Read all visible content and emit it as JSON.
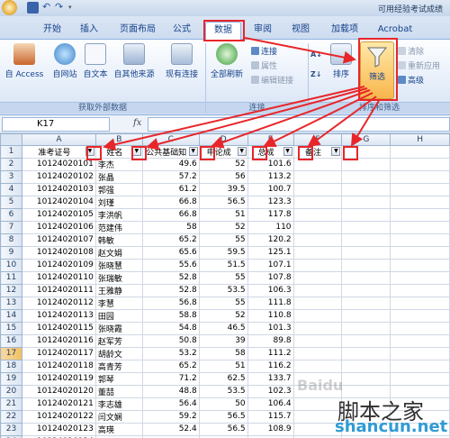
{
  "title_bar": {
    "title": "可用经验考试成绩"
  },
  "tabs": [
    "开始",
    "插入",
    "页面布局",
    "公式",
    "数据",
    "审阅",
    "视图",
    "加载项",
    "Acrobat"
  ],
  "ribbon": {
    "get_external": {
      "from_access": "自 Access",
      "from_web": "自网站",
      "from_text": "自文本",
      "from_other": "自其他来源",
      "existing": "现有连接",
      "label": "获取外部数据"
    },
    "connections": {
      "refresh_all": "全部刷新",
      "connections": "连接",
      "properties": "属性",
      "edit_links": "编辑链接",
      "label": "连接"
    },
    "sort_filter": {
      "sort": "排序",
      "filter": "筛选",
      "clear": "清除",
      "reapply": "重新应用",
      "advanced": "高级",
      "label": "排序和筛选"
    }
  },
  "formula_bar": {
    "name_box": "K17",
    "fx": "fx"
  },
  "columns": [
    "A",
    "B",
    "C",
    "D",
    "E",
    "F",
    "G",
    "H"
  ],
  "header_row": [
    "准考证号",
    "姓名",
    "公共基础知",
    "申论成",
    "总成",
    "备注"
  ],
  "rows": [
    [
      "10124020101",
      "李杰",
      "49.6",
      "52",
      "101.6"
    ],
    [
      "10124020102",
      "张晶",
      "57.2",
      "56",
      "113.2"
    ],
    [
      "10124020103",
      "郭强",
      "61.2",
      "39.5",
      "100.7"
    ],
    [
      "10124020104",
      "刘瑾",
      "66.8",
      "56.5",
      "123.3"
    ],
    [
      "10124020105",
      "李洪帆",
      "66.8",
      "51",
      "117.8"
    ],
    [
      "10124020106",
      "范建伟",
      "58",
      "52",
      "110"
    ],
    [
      "10124020107",
      "韩敏",
      "65.2",
      "55",
      "120.2"
    ],
    [
      "10124020108",
      "赵文娟",
      "65.6",
      "59.5",
      "125.1"
    ],
    [
      "10124020109",
      "张晓慧",
      "55.6",
      "51.5",
      "107.1"
    ],
    [
      "10124020110",
      "张瑞敏",
      "52.8",
      "55",
      "107.8"
    ],
    [
      "10124020111",
      "王雅静",
      "52.8",
      "53.5",
      "106.3"
    ],
    [
      "10124020112",
      "李慧",
      "56.8",
      "55",
      "111.8"
    ],
    [
      "10124020113",
      "田园",
      "58.8",
      "52",
      "110.8"
    ],
    [
      "10124020115",
      "张晓霞",
      "54.8",
      "46.5",
      "101.3"
    ],
    [
      "10124020116",
      "赵军芳",
      "50.8",
      "39",
      "89.8"
    ],
    [
      "10124020117",
      "胡龄文",
      "53.2",
      "58",
      "111.2"
    ],
    [
      "10124020118",
      "高青芳",
      "65.2",
      "51",
      "116.2"
    ],
    [
      "10124020119",
      "郭琴",
      "71.2",
      "62.5",
      "133.7"
    ],
    [
      "10124020120",
      "董喆",
      "48.8",
      "53.5",
      "102.3"
    ],
    [
      "10124020121",
      "李志雄",
      "56.4",
      "50",
      "106.4"
    ],
    [
      "10124020122",
      "闫文娴",
      "59.2",
      "56.5",
      "115.7"
    ],
    [
      "10124020123",
      "高瑛",
      "52.4",
      "56.5",
      "108.9"
    ],
    [
      "10124020124",
      "",
      "",
      "",
      ""
    ]
  ],
  "row_numbers": [
    "1",
    "2",
    "3",
    "4",
    "5",
    "6",
    "7",
    "8",
    "9",
    "10",
    "11",
    "12",
    "13",
    "14",
    "15",
    "16",
    "17",
    "18",
    "19",
    "20",
    "21",
    "22",
    "23",
    "24",
    "25"
  ],
  "watermark": {
    "baidu": "Baidu",
    "cn": "脚本之家",
    "en": "shancun.net"
  },
  "colors": {
    "annotation": "#e8262a",
    "ribbon_text": "#15428b",
    "selected_header": "#f1c15f"
  }
}
